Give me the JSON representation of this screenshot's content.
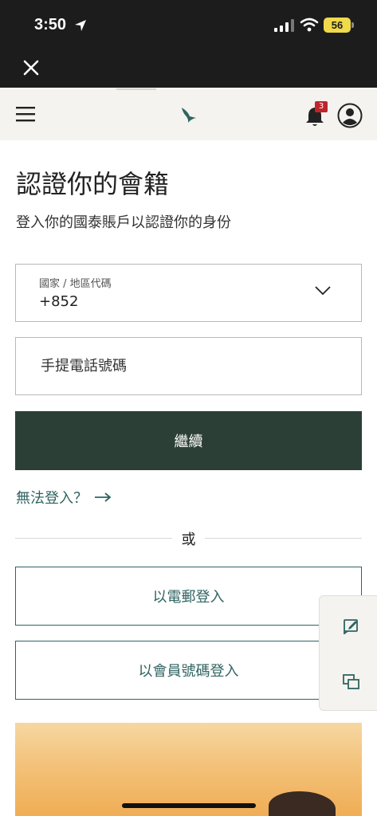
{
  "status_bar": {
    "time": "3:50",
    "battery": "56",
    "icons": [
      "location-arrow-icon",
      "signal-icon",
      "wifi-icon",
      "battery-icon"
    ]
  },
  "header": {
    "notification_count": "3",
    "icons": [
      "menu-icon",
      "airline-logo-icon",
      "bell-icon",
      "account-icon",
      "close-icon"
    ]
  },
  "page": {
    "title": "認證你的會籍",
    "subtitle": "登入你的國泰賬戶以認證你的身份"
  },
  "form": {
    "country_label": "國家 / 地區代碼",
    "country_value": "+852",
    "phone_placeholder": "手提電話號碼",
    "continue_label": "繼續"
  },
  "links": {
    "cant_login": "無法登入？"
  },
  "divider_text": "或",
  "alt_login": {
    "email_label": "以電郵登入",
    "member_label": "以會員號碼登入"
  },
  "side_panel": {
    "icons": [
      "feedback-icon",
      "chat-icon"
    ]
  },
  "colors": {
    "primary_dark": "#2c3f36",
    "accent_teal": "#2f6461",
    "header_bg": "#f4f3ef",
    "badge_red": "#c0252c"
  }
}
